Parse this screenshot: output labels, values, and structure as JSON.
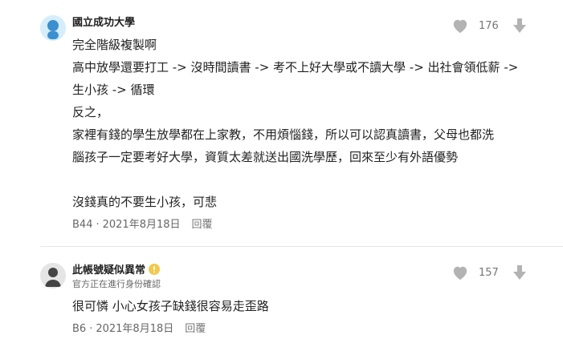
{
  "comments": [
    {
      "author": "國立成功大學",
      "subtitle": "",
      "likes": "176",
      "icons": {
        "like": "heart-icon",
        "dislike": "down-arrow-icon"
      },
      "lines": [
        "完全階級複製啊",
        "高中放學還要打工 -> 沒時間讀書 -> 考不上好大學或不讀大學 -> 出社會領低薪 ->",
        "生小孩 -> 循環",
        "反之，",
        "家裡有錢的學生放學都在上家教，不用煩惱錢，所以可以認真讀書，父母也都洗",
        "腦孩子一定要考好大學，資質太差就送出國洗學歷，回來至少有外語優勢",
        "",
        "沒錢真的不要生小孩，可悲"
      ],
      "floor": "B44",
      "date": "2021年8月18日",
      "reply_label": "回覆"
    },
    {
      "author": "此帳號疑似異常",
      "subtitle": "官方正在進行身份確認",
      "warning_icon": "warning-icon",
      "likes": "157",
      "icons": {
        "like": "heart-icon",
        "dislike": "down-arrow-icon"
      },
      "lines": [
        "很可憐 小心女孩子缺錢很容易走歪路"
      ],
      "floor": "B6",
      "date": "2021年8月18日",
      "reply_label": "回覆"
    }
  ],
  "colors": {
    "icon_gray": "#b3b3b3",
    "divider": "#e6e6e6",
    "warning": "#f2c94c"
  }
}
